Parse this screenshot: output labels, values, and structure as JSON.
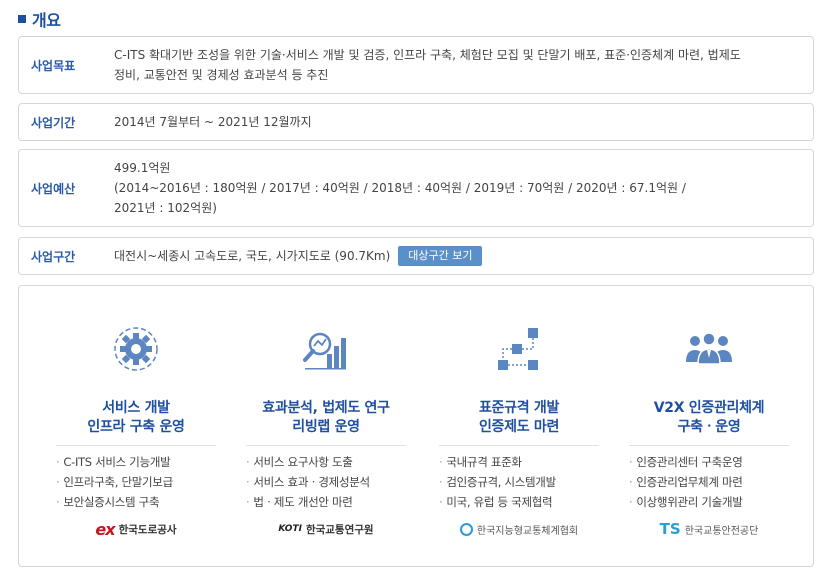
{
  "section": {
    "title": "개요"
  },
  "rows": {
    "goal": {
      "label": "사업목표",
      "lines": [
        "C-ITS 확대기반 조성을 위한 기술·서비스 개발 및 검증, 인프라 구축, 체험단 모집 및 단말기 배포, 표준·인증체계 마련, 법제도",
        "정비, 교통안전 및 경제성 효과분석 등 추진"
      ]
    },
    "period": {
      "label": "사업기간",
      "text": "2014년 7월부터 ~ 2021년 12월까지"
    },
    "budget": {
      "label": "사업예산",
      "lines": [
        "499.1억원",
        "(2014~2016년 : 180억원 / 2017년 : 40억원 / 2018년 : 40억원 / 2019년 : 70억원 / 2020년 : 67.1억원 /",
        "2021년 : 102억원)"
      ]
    },
    "section_range": {
      "label": "사업구간",
      "text": "대전시~세종시 고속도로, 국도, 시가지도로 (90.7Km)",
      "button": "대상구간 보기"
    }
  },
  "columns": [
    {
      "heading": [
        "서비스 개발",
        "인프라 구축 운영"
      ],
      "icon": "gear-icon",
      "items": [
        "C-ITS 서비스 기능개발",
        "인프라구축, 단말기보급",
        "보안실증시스템 구축"
      ],
      "logo": {
        "mark": "ex",
        "name": "한국도로공사"
      }
    },
    {
      "heading": [
        "효과분석, 법제도 연구",
        "리빙랩 운영"
      ],
      "icon": "analysis-chart-icon",
      "items": [
        "서비스 요구사항 도출",
        "서비스 효과ㆍ경제성분석",
        "법ㆍ제도 개선안 마련"
      ],
      "logo": {
        "mark": "KOTI",
        "name": "한국교통연구원"
      }
    },
    {
      "heading": [
        "표준규격 개발",
        "인증제도 마련"
      ],
      "icon": "flowchart-icon",
      "items": [
        "국내규격 표준화",
        "검인증규격, 시스템개발",
        "미국, 유럽 등 국제협력"
      ],
      "logo": {
        "mark": "",
        "name": "한국지능형교통체계협회"
      }
    },
    {
      "heading": [
        "V2X 인증관리체계",
        "구축ㆍ운영"
      ],
      "icon": "people-group-icon",
      "items": [
        "인증관리센터 구축운영",
        "인증관리업무체계 마련",
        "이상행위관리 기술개발"
      ],
      "logo": {
        "mark": "TS",
        "name": "한국교통안전공단"
      }
    }
  ],
  "colors": {
    "accent": "#1f4fa0",
    "label": "#2b5aa7",
    "button": "#5a8fc8",
    "icon": "#5b86c2"
  }
}
